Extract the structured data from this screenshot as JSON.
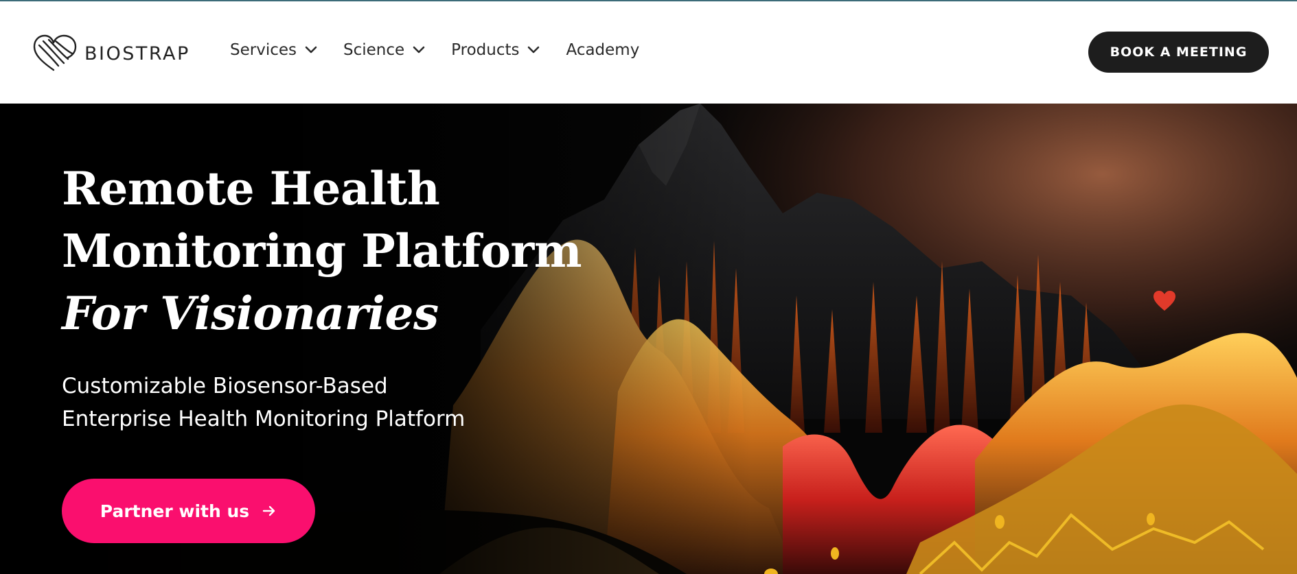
{
  "header": {
    "logo_text": "BIOSTRAP",
    "nav": [
      {
        "label": "Services",
        "has_dropdown": true
      },
      {
        "label": "Science",
        "has_dropdown": true
      },
      {
        "label": "Products",
        "has_dropdown": true
      },
      {
        "label": "Academy",
        "has_dropdown": false
      }
    ],
    "cta_label": "BOOK A MEETING"
  },
  "hero": {
    "title_line1": "Remote Health",
    "title_line2": "Monitoring Platform",
    "title_line3": "For Visionaries",
    "subtitle_line1": "Customizable Biosensor-Based",
    "subtitle_line2": "Enterprise Health Monitoring Platform",
    "cta_label": "Partner with us"
  },
  "colors": {
    "header_bg": "#ffffff",
    "top_button_bg": "#1d1d1d",
    "hero_cta_bg": "#fa0f6e",
    "hero_bg": "#050505",
    "text_light": "#ffffff"
  },
  "icons": {
    "logo": "heart-lines-logo-icon",
    "dropdown": "chevron-down-icon",
    "cta_arrow": "arrow-right-icon",
    "heart": "heart-icon"
  }
}
